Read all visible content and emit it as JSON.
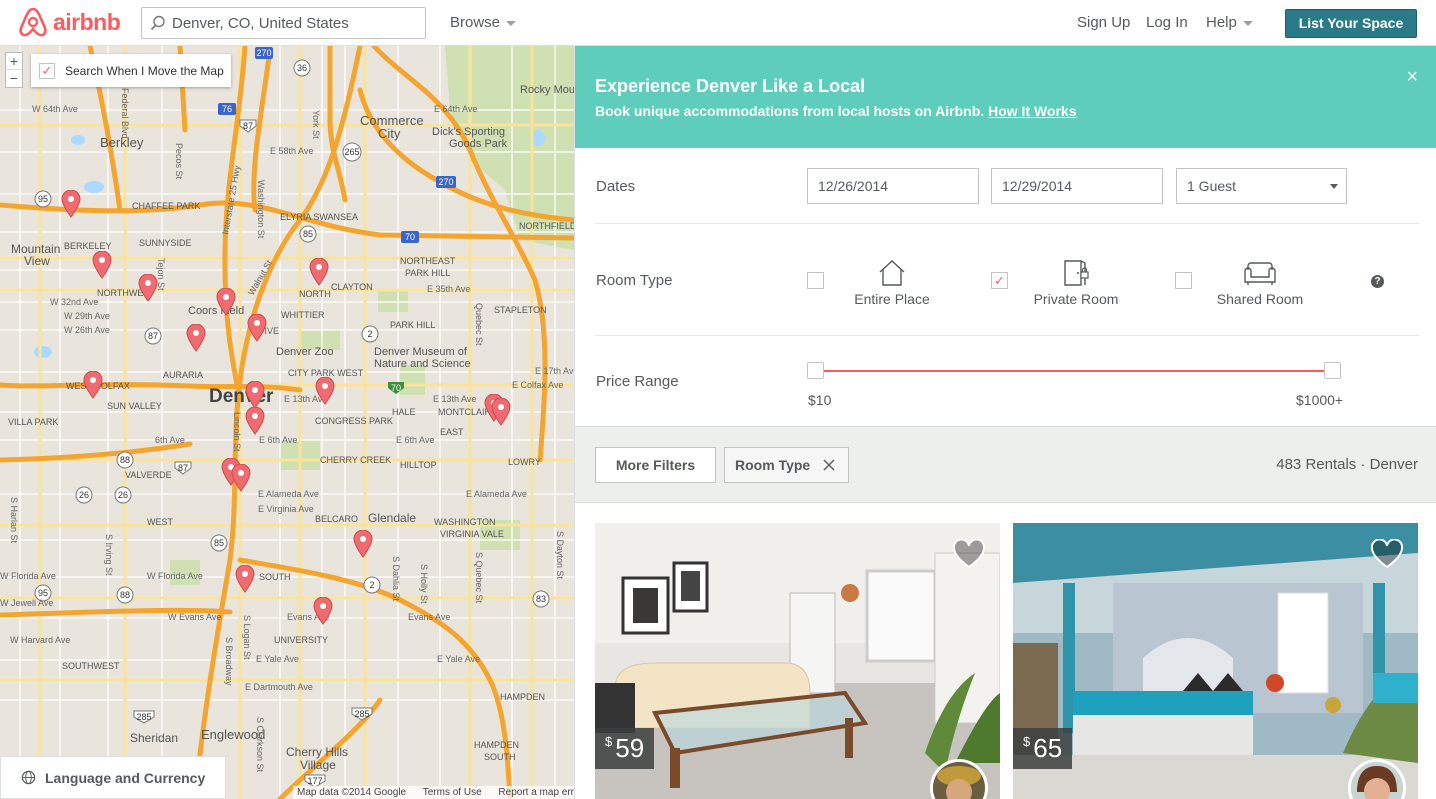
{
  "header": {
    "brand": "airbnb",
    "search_value": "Denver, CO, United States",
    "browse_label": "Browse",
    "signup_label": "Sign Up",
    "login_label": "Log In",
    "help_label": "Help",
    "list_space_label": "List Your Space",
    "brand_color": "#ff5a5f",
    "accent_color": "#2b7a88"
  },
  "map": {
    "zoom_in": "+",
    "zoom_out": "−",
    "move_checkbox_checked": true,
    "move_checkbox_label": "Search When I Move the Map",
    "language_currency_label": "Language and Currency",
    "attribution": [
      "Map data ©2014 Google",
      "Terms of Use",
      "Report a map error"
    ],
    "labels": {
      "rocky": "Rocky Mou",
      "berkley": "Berkley",
      "commerce": "Commerce",
      "city": "City",
      "dicks": "Dick's Sporting",
      "goods": "Goods Park",
      "mountain": "Mountain",
      "view": "View",
      "chaffee": "CHAFFEE PARK",
      "elyria": "ELYRIA SWANSEA",
      "northfield": "NORTHFIELD",
      "berkeley": "BERKELEY",
      "sunnyside": "SUNNYSIDE",
      "northeast": "NORTHEAST",
      "park_hill_n": "PARK HILL",
      "northwest": "NORTHWE",
      "north": "NORTH",
      "clayton": "CLAYTON",
      "stapleton": "STAPLETON",
      "whittier": "WHITTIER",
      "park_hill": "PARK HILL",
      "coors": "Coors Field",
      "five": "FIVE",
      "denver_zoo": "Denver Zoo",
      "museum1": "Denver Museum of",
      "museum2": "Nature and Science",
      "auraria": "AURARIA",
      "city_park_west": "CITY PARK WEST",
      "denver": "Denver",
      "west_colfax": "WEST COLFAX",
      "sun_valley": "SUN VALLEY",
      "villa_park": "VILLA PARK",
      "congress_park": "CONGRESS PARK",
      "hale": "HALE",
      "montclair": "MONTCLAIR",
      "east": "EAST",
      "lowry": "LOWRY",
      "cherry_creek": "CHERRY CREEK",
      "hilltop": "HILLTOP",
      "valverde": "VALVERDE",
      "west": "WEST",
      "belcaro": "BELCARO",
      "glendale": "Glendale",
      "washington_virginia": "WASHINGTON",
      "virginia_vale": "VIRGINIA VALE",
      "south": "SOUTH",
      "university": "UNIVERSITY",
      "southwest": "SOUTHWEST",
      "hampden": "HAMPDEN",
      "hampden_south": "HAMPDEN",
      "south2": "SOUTH",
      "sheridan": "Sheridan",
      "englewood": "Englewood",
      "cherry_hills": "Cherry Hills",
      "village": "Village",
      "w64": "W 64th Ave",
      "e64": "E 64th Ave",
      "e58": "E 58th Ave",
      "w32": "W 32nd Ave",
      "w29": "W 29th Ave",
      "w26": "W 26th Ave",
      "e35": "E 35th Ave",
      "e17": "E 17th Ave",
      "e_colfax": "E Colfax Ave",
      "e13": "E 13th Ave",
      "e13b": "E 13th Ave",
      "e6": "E 6th Ave",
      "e6b": "E 6th Ave",
      "sixth": "6th Ave",
      "e_alameda": "E Alameda Ave",
      "e_alameda2": "E Alameda Ave",
      "e_virginia": "E Virginia Ave",
      "w_florida": "W Florida Ave",
      "w_florida2": "W Florida Ave",
      "w_jewell": "W Jewell Ave",
      "w_evans": "W Evans Ave",
      "evans": "Evans Ave",
      "evans2": "Evans Ave",
      "w_harvard": "W Harvard Ave",
      "e_yale": "E Yale Ave",
      "e_yale2": "E Yale Ave",
      "e_dartmouth": "E Dartmouth Ave",
      "lincoln": "Lincoln St",
      "walnut": "Walnut St",
      "york": "York St",
      "washington_st": "Washington St",
      "interstate25": "Interstate 25 Hwy",
      "pecos": "Pecos St",
      "federal": "Federal Blvd",
      "tejon": "Tejon St",
      "quebec": "Quebec St",
      "logan": "S Logan St",
      "broadway": "S Broadway",
      "dahlia": "S Dahlia St",
      "holly": "S Holly St",
      "quebec_s": "S Quebec St",
      "dayton": "S Dayton St",
      "clarkson": "S Clarkson St",
      "harlan": "S Harlan St",
      "irving": "S Irving St"
    },
    "route_badges": [
      "270",
      "36",
      "76",
      "87",
      "265",
      "270",
      "95",
      "25",
      "85",
      "70",
      "2",
      "87",
      "70",
      "88",
      "87",
      "26",
      "26",
      "85",
      "2",
      "95",
      "88",
      "83",
      "285",
      "285",
      "177"
    ]
  },
  "banner": {
    "title": "Experience Denver Like a Local",
    "text": "Book unique accommodations from local hosts on Airbnb.",
    "link": "How It Works",
    "close": "×"
  },
  "filters": {
    "dates_label": "Dates",
    "checkin": "12/26/2014",
    "checkout": "12/29/2014",
    "guests": "1 Guest",
    "room_type_label": "Room Type",
    "room_types": [
      {
        "label": "Entire Place",
        "checked": false
      },
      {
        "label": "Private Room",
        "checked": true
      },
      {
        "label": "Shared Room",
        "checked": false
      }
    ],
    "help_icon": "?",
    "price_label": "Price Range",
    "price_min": "$10",
    "price_max": "$1000+",
    "more_filters": "More Filters",
    "active_filter": "Room Type",
    "rentals_count": "483 Rentals · Denver"
  },
  "listings": [
    {
      "currency": "$",
      "price": "59",
      "icon": "heart-icon"
    },
    {
      "currency": "$",
      "price": "65",
      "icon": "heart-icon"
    }
  ]
}
